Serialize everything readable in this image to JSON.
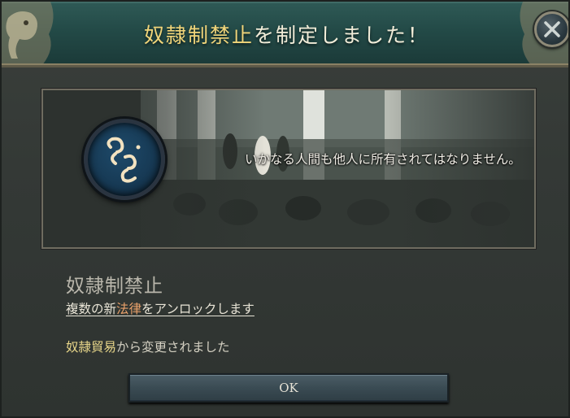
{
  "dialog": {
    "title_highlight": "奴隷制禁止",
    "title_rest": "を制定しました！",
    "quote": "いかなる人間も他人に所有されてはなりません。",
    "law_name": "奴隷制禁止",
    "unlock": {
      "prefix": "複数の新",
      "link": "法律",
      "suffix": "をアンロックします"
    },
    "changed_from": {
      "previous_law": "奴隷貿易",
      "suffix": "から変更されました"
    },
    "ok_label": "OK",
    "close_symbol": "✕"
  },
  "colors": {
    "header_teal": "#234a47",
    "title_highlight": "#f0d57a",
    "law_link": "#e8a06a",
    "previous_law": "#e8d68a",
    "medallion_blue": "#1e4a6a"
  },
  "icons": {
    "close": "close-icon",
    "medallion": "broken-chain-icon",
    "ornament": "elephant-ornament-icon"
  }
}
